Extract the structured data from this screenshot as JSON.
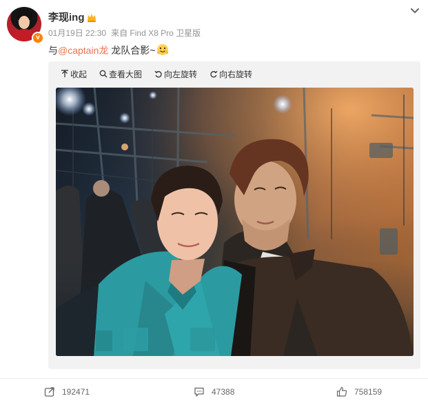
{
  "post": {
    "username": "李现ing",
    "date": "01月19日 22:30",
    "source": "来自 Find X8 Pro 卫星版",
    "text_prefix": "与",
    "mention": "@captain龙",
    "text_suffix": " 龙队合影~"
  },
  "toolbar": {
    "collapse": "收起",
    "view_large": "查看大图",
    "rotate_left": "向左旋转",
    "rotate_right": "向右旋转"
  },
  "actions": {
    "forward_count": "192471",
    "comment_count": "47388",
    "like_count": "758159"
  },
  "icons": {
    "verified": "verified-badge-icon",
    "member": "crown-icon",
    "more": "chevron-down-icon",
    "emoji": "hug-emoji-icon",
    "forward": "forward-icon",
    "comment": "comment-icon",
    "like": "thumbs-up-icon"
  },
  "colors": {
    "accent_orange": "#ff8200",
    "mention_color": "#eb7350",
    "media_bg": "#f2f2f2"
  }
}
